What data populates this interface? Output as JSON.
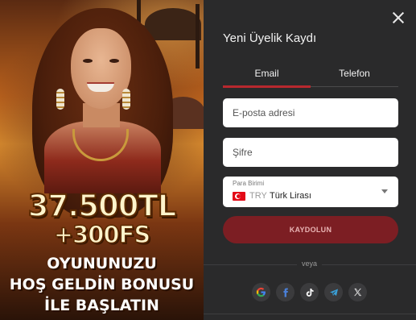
{
  "promo": {
    "amount": "37.500TL",
    "free_spins": "+300FS",
    "line1": "OYUNUNUZU",
    "line2": "HOŞ GELDİN BONUSU",
    "line3": "İLE BAŞLATIN"
  },
  "form": {
    "title": "Yeni Üyelik Kaydı",
    "tabs": [
      {
        "label": "Email",
        "active": true
      },
      {
        "label": "Telefon",
        "active": false
      }
    ],
    "email_placeholder": "E-posta adresi",
    "password_placeholder": "Şifre",
    "currency": {
      "label": "Para Birimi",
      "code": "TRY",
      "name": "Türk Lirası"
    },
    "submit_label": "KAYDOLUN",
    "divider_text": "veya"
  },
  "socials": [
    {
      "icon": "google-icon"
    },
    {
      "icon": "facebook-icon"
    },
    {
      "icon": "tiktok-icon"
    },
    {
      "icon": "telegram-icon"
    },
    {
      "icon": "x-icon"
    }
  ],
  "colors": {
    "accent": "#b8282e",
    "button": "#7c1e23",
    "panel_bg": "#2a2a2b"
  }
}
